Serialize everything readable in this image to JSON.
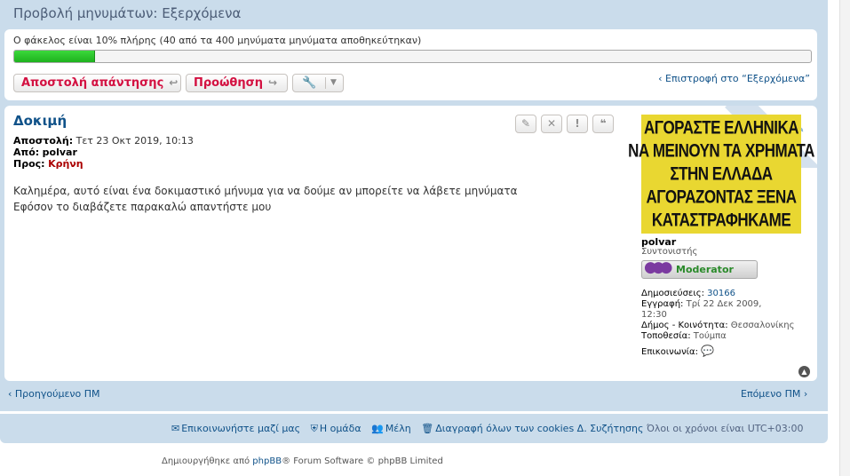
{
  "page_title": "Προβολή μηνυμάτων: Εξερχόμενα",
  "folder_status": {
    "text": "Ο φάκελος είναι 10% πλήρης (40 από τα 400 μηνύματα μηνύματα αποθηκεύτηκαν)",
    "fill_percent": 10,
    "fill_color": "#2fc92f"
  },
  "actions": {
    "reply_label": "Αποστολή απάντησης",
    "forward_label": "Προώθηση",
    "return_link": "Επιστροφή στο “Εξερχόμενα”"
  },
  "message": {
    "title": "Δοκιμή",
    "sent_label": "Αποστολή:",
    "sent_value": "Τετ 23 Οκτ 2019, 10:13",
    "from_label": "Από:",
    "from_value": "polvar",
    "to_label": "Προς:",
    "to_value": "Κρήνη",
    "body_line1": "Καλημέρα, αυτό είναι ένα δοκιμαστικό μήνυμα για να δούμε αν μπορείτε να λάβετε μηνύματα",
    "body_line2": "Εφόσον το διαβάζετε παρακαλώ απαντήστε μου"
  },
  "profile": {
    "avatar_lines": [
      "ΑΓΟΡΑΣΤΕ ΕΛΛΗΝΙΚΑ",
      "ΝΑ ΜΕΙΝΟΥΝ ΤΑ ΧΡΗΜΑΤΑ",
      "ΣΤΗΝ ΕΛΛΑΔΑ",
      "ΑΓΟΡΑΖΟΝΤΑΣ ΞΕΝΑ",
      "ΚΑΤΑΣΤΡΑΦΗΚΑΜΕ"
    ],
    "username": "polvar",
    "rank": "Συντονιστής",
    "badge": "Moderator",
    "posts_label": "Δημοσιεύσεις:",
    "posts_value": "30166",
    "joined_label": "Εγγραφή:",
    "joined_value_1": "Τρί 22 Δεκ 2009,",
    "joined_value_2": "12:30",
    "municipality_label": "Δήμος - Κοινότητα:",
    "municipality_value": "Θεσσαλονίκης",
    "location_label": "Τοποθεσία:",
    "location_value": "Τούμπα",
    "contact_label": "Επικοινωνία:"
  },
  "navigation": {
    "prev": "Προηγούμενο ΠΜ",
    "next": "Επόμενο ΠΜ"
  },
  "footer": {
    "contact": "Επικοινωνήστε μαζί μας",
    "team": "Η ομάδα",
    "members": "Μέλη",
    "delete_cookies": "Διαγραφή όλων των cookies Δ. Συζήτησης",
    "timezone": "Όλοι οι χρόνοι είναι UTC+03:00"
  },
  "credit": {
    "prefix": "Δημιουργήθηκε από",
    "phpbb": "phpBB",
    "suffix": "® Forum Software © phpBB Limited"
  }
}
